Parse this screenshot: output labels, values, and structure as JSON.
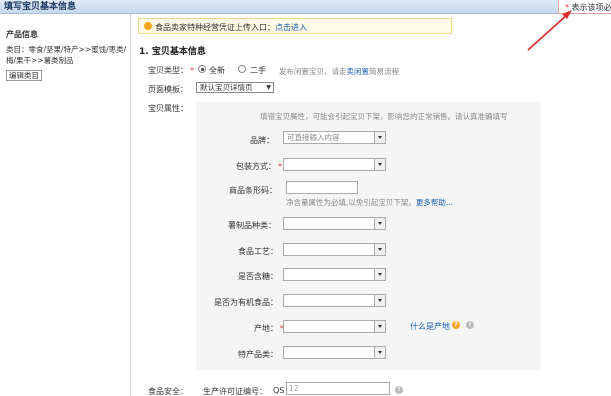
{
  "header": {
    "title": "填写宝贝基本信息",
    "required_hint": "表示该项必"
  },
  "sidebar": {
    "title": "产品信息",
    "category": "类目：零食/坚果/特产>>蜜饯/枣类/梅/果干>>薯类制品",
    "edit_button": "编辑类目"
  },
  "notice": {
    "text": "食品卖家特种经营凭证上传入口：",
    "link": "点击进入"
  },
  "section": {
    "title": "1. 宝贝基本信息"
  },
  "item_type": {
    "label": "宝贝类型：",
    "options": [
      "全新",
      "二手"
    ],
    "selected": "全新",
    "hint_prefix": "发布闲置宝贝，请走",
    "hint_link": "卖闲置",
    "hint_suffix": "简易流程"
  },
  "page_template": {
    "label": "页面模板：",
    "value": "默认宝贝详情页"
  },
  "attributes": {
    "label": "宝贝属性：",
    "hint": "填错宝贝属性，可能会引起宝贝下架，影响您的正常销售。请认真准确填写",
    "brand_label": "品牌：",
    "brand_placeholder": "可直接输入内容",
    "packaging_label": "包装方式：",
    "barcode_label": "商品条形码：",
    "barcode_hint": "净含量属性为必填,以免引起宝贝下架。",
    "barcode_help": "更多帮助...",
    "potato_type_label": "薯制品种类：",
    "process_label": "食品工艺：",
    "sugar_label": "是否含糖：",
    "organic_label": "是否为有机食品：",
    "origin_label": "产地：",
    "origin_help": "什么是产地",
    "specialty_label": "特产品类："
  },
  "food_safety": {
    "label": "食品安全：",
    "license_label": "生产许可证编号：",
    "license_prefix": "QS",
    "license_value": "12"
  }
}
